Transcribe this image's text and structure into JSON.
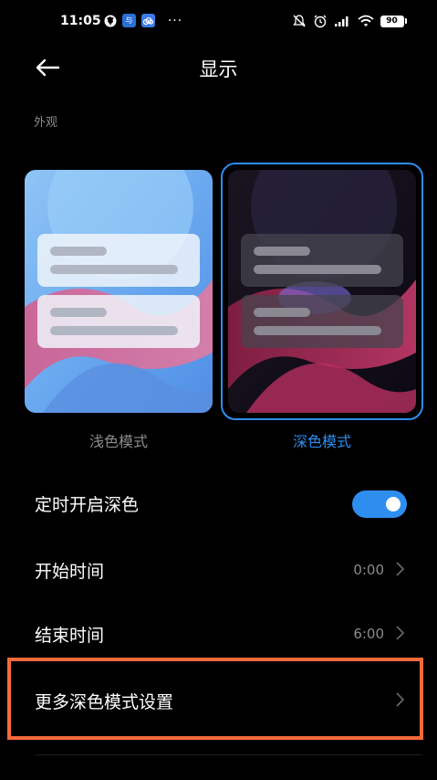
{
  "status_bar": {
    "time": "11:05",
    "app_icon_1_text": "与",
    "dots": "···",
    "battery": "90"
  },
  "header": {
    "title": "显示"
  },
  "appearance": {
    "section_label": "外观",
    "light_label": "浅色模式",
    "dark_label": "深色模式",
    "selected": "dark"
  },
  "settings": {
    "schedule_dark": {
      "label": "定时开启深色",
      "enabled": true
    },
    "start_time": {
      "label": "开始时间",
      "value": "0:00"
    },
    "end_time": {
      "label": "结束时间",
      "value": "6:00"
    },
    "more_settings": {
      "label": "更多深色模式设置"
    }
  },
  "colors": {
    "accent": "#2e8ef0",
    "highlight": "#f36a3b",
    "secondary_text": "#8c8c8c"
  }
}
